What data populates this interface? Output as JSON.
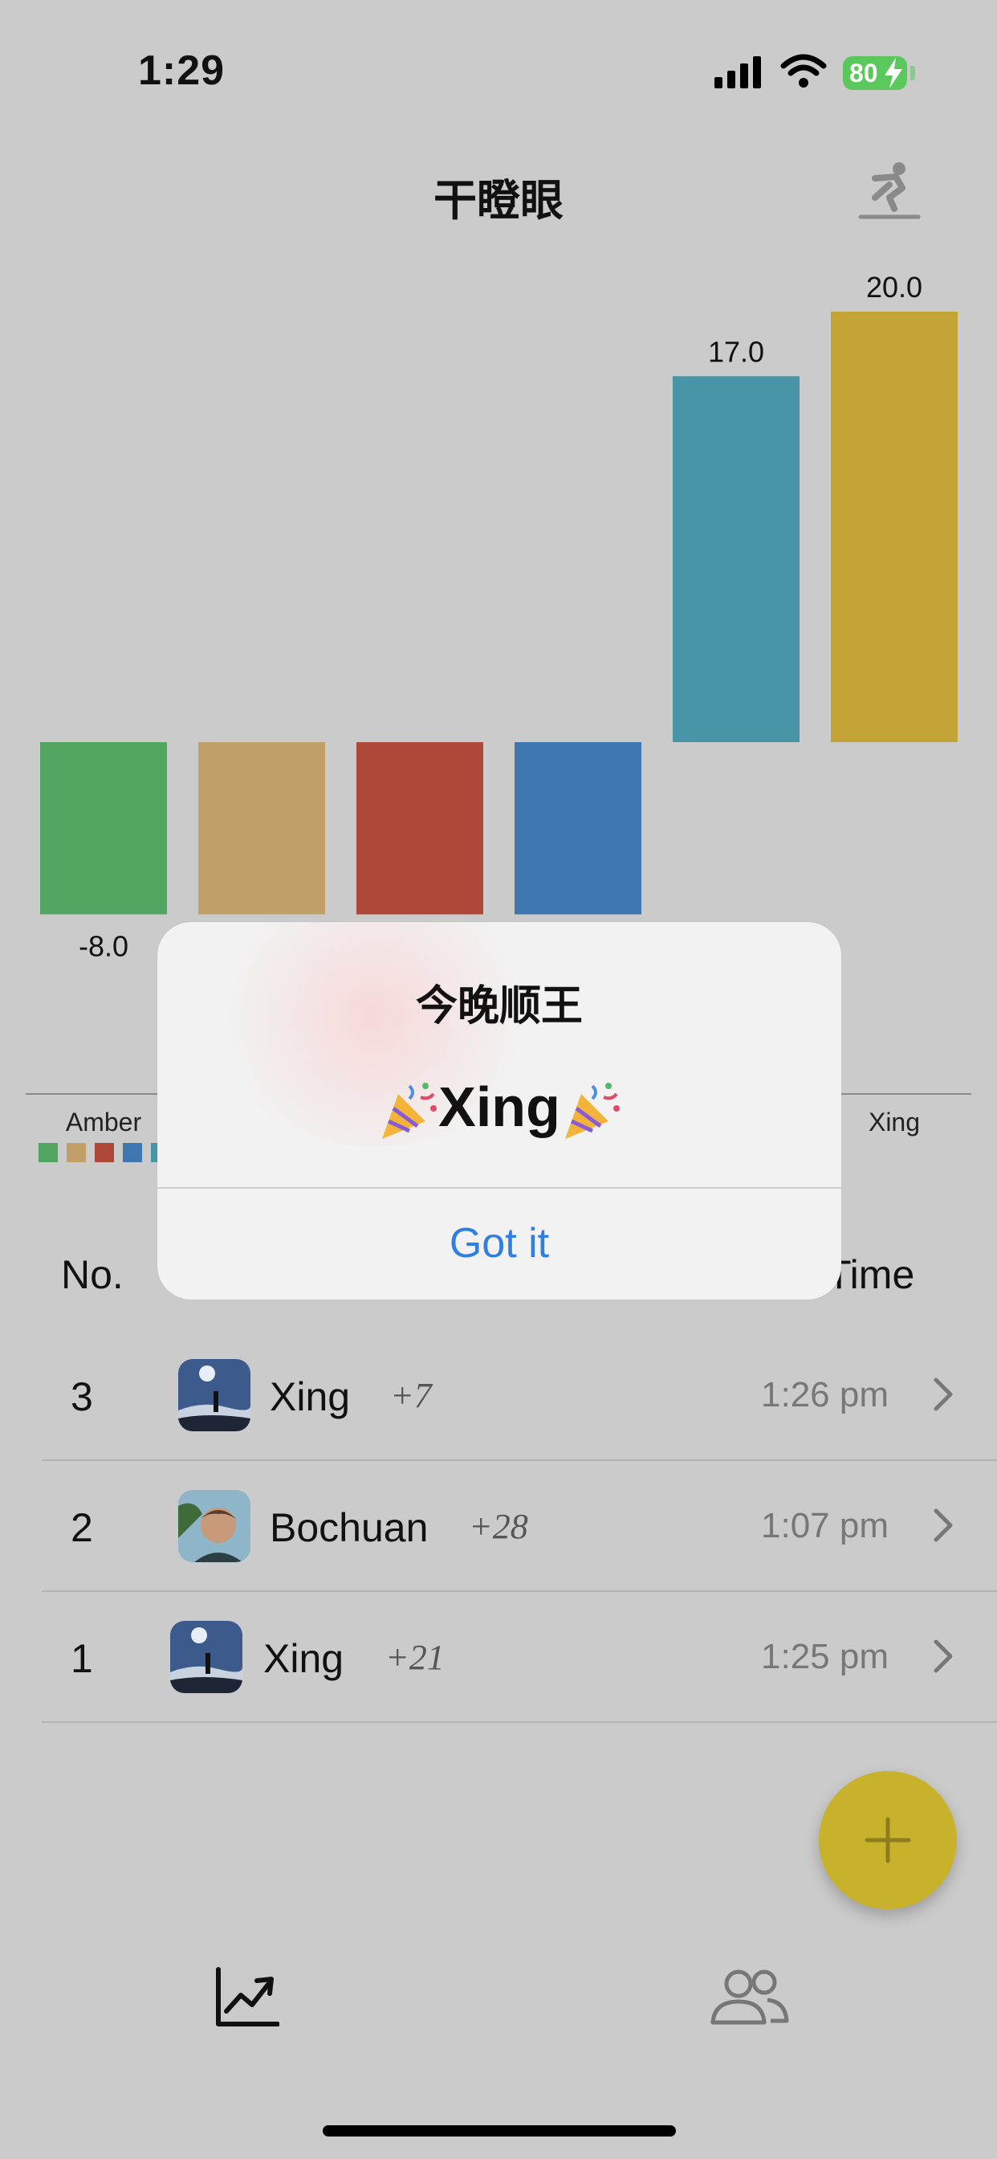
{
  "status_bar": {
    "time": "1:29",
    "battery": "80"
  },
  "nav": {
    "title": "干瞪眼",
    "action_icon": "snowboarder-icon"
  },
  "chart_data": {
    "type": "bar",
    "categories": [
      "Amber",
      "",
      "",
      "",
      "",
      "Xing"
    ],
    "values": [
      -8.0,
      -8.0,
      -8.0,
      -8.0,
      17.0,
      20.0
    ],
    "value_labels": [
      "-8.0",
      "",
      "",
      "",
      "17.0",
      "20.0"
    ],
    "colors": [
      "#52a461",
      "#c0a068",
      "#ad4737",
      "#3f78b0",
      "#4795a6",
      "#c3a336"
    ],
    "legend_colors": [
      "#52a461",
      "#c0a068",
      "#ad4737",
      "#3f78b0",
      "#4795a6"
    ],
    "ylim": [
      -8,
      20
    ]
  },
  "table": {
    "headers": {
      "no": "No.",
      "time": "Time"
    },
    "rows": [
      {
        "no": "3",
        "name": "Xing",
        "delta": "+7",
        "time": "1:26 pm"
      },
      {
        "no": "2",
        "name": "Bochuan",
        "delta": "+28",
        "time": "1:07 pm"
      },
      {
        "no": "1",
        "name": "Xing",
        "delta": "+21",
        "time": "1:25 pm"
      }
    ]
  },
  "alert": {
    "title": "今晚顺王",
    "message": "Xing",
    "button": "Got it"
  },
  "tabs": {
    "left_icon": "chart-trend-icon",
    "right_icon": "people-icon"
  }
}
